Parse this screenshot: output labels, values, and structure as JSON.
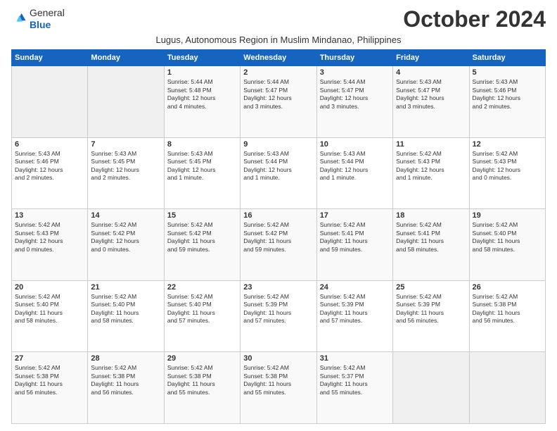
{
  "header": {
    "logo_line1": "General",
    "logo_line2": "Blue",
    "month": "October 2024",
    "location": "Lugus, Autonomous Region in Muslim Mindanao, Philippines"
  },
  "weekdays": [
    "Sunday",
    "Monday",
    "Tuesday",
    "Wednesday",
    "Thursday",
    "Friday",
    "Saturday"
  ],
  "weeks": [
    [
      {
        "day": "",
        "info": ""
      },
      {
        "day": "",
        "info": ""
      },
      {
        "day": "1",
        "info": "Sunrise: 5:44 AM\nSunset: 5:48 PM\nDaylight: 12 hours\nand 4 minutes."
      },
      {
        "day": "2",
        "info": "Sunrise: 5:44 AM\nSunset: 5:47 PM\nDaylight: 12 hours\nand 3 minutes."
      },
      {
        "day": "3",
        "info": "Sunrise: 5:44 AM\nSunset: 5:47 PM\nDaylight: 12 hours\nand 3 minutes."
      },
      {
        "day": "4",
        "info": "Sunrise: 5:43 AM\nSunset: 5:47 PM\nDaylight: 12 hours\nand 3 minutes."
      },
      {
        "day": "5",
        "info": "Sunrise: 5:43 AM\nSunset: 5:46 PM\nDaylight: 12 hours\nand 2 minutes."
      }
    ],
    [
      {
        "day": "6",
        "info": "Sunrise: 5:43 AM\nSunset: 5:46 PM\nDaylight: 12 hours\nand 2 minutes."
      },
      {
        "day": "7",
        "info": "Sunrise: 5:43 AM\nSunset: 5:45 PM\nDaylight: 12 hours\nand 2 minutes."
      },
      {
        "day": "8",
        "info": "Sunrise: 5:43 AM\nSunset: 5:45 PM\nDaylight: 12 hours\nand 1 minute."
      },
      {
        "day": "9",
        "info": "Sunrise: 5:43 AM\nSunset: 5:44 PM\nDaylight: 12 hours\nand 1 minute."
      },
      {
        "day": "10",
        "info": "Sunrise: 5:43 AM\nSunset: 5:44 PM\nDaylight: 12 hours\nand 1 minute."
      },
      {
        "day": "11",
        "info": "Sunrise: 5:42 AM\nSunset: 5:43 PM\nDaylight: 12 hours\nand 1 minute."
      },
      {
        "day": "12",
        "info": "Sunrise: 5:42 AM\nSunset: 5:43 PM\nDaylight: 12 hours\nand 0 minutes."
      }
    ],
    [
      {
        "day": "13",
        "info": "Sunrise: 5:42 AM\nSunset: 5:43 PM\nDaylight: 12 hours\nand 0 minutes."
      },
      {
        "day": "14",
        "info": "Sunrise: 5:42 AM\nSunset: 5:42 PM\nDaylight: 12 hours\nand 0 minutes."
      },
      {
        "day": "15",
        "info": "Sunrise: 5:42 AM\nSunset: 5:42 PM\nDaylight: 11 hours\nand 59 minutes."
      },
      {
        "day": "16",
        "info": "Sunrise: 5:42 AM\nSunset: 5:42 PM\nDaylight: 11 hours\nand 59 minutes."
      },
      {
        "day": "17",
        "info": "Sunrise: 5:42 AM\nSunset: 5:41 PM\nDaylight: 11 hours\nand 59 minutes."
      },
      {
        "day": "18",
        "info": "Sunrise: 5:42 AM\nSunset: 5:41 PM\nDaylight: 11 hours\nand 58 minutes."
      },
      {
        "day": "19",
        "info": "Sunrise: 5:42 AM\nSunset: 5:40 PM\nDaylight: 11 hours\nand 58 minutes."
      }
    ],
    [
      {
        "day": "20",
        "info": "Sunrise: 5:42 AM\nSunset: 5:40 PM\nDaylight: 11 hours\nand 58 minutes."
      },
      {
        "day": "21",
        "info": "Sunrise: 5:42 AM\nSunset: 5:40 PM\nDaylight: 11 hours\nand 58 minutes."
      },
      {
        "day": "22",
        "info": "Sunrise: 5:42 AM\nSunset: 5:40 PM\nDaylight: 11 hours\nand 57 minutes."
      },
      {
        "day": "23",
        "info": "Sunrise: 5:42 AM\nSunset: 5:39 PM\nDaylight: 11 hours\nand 57 minutes."
      },
      {
        "day": "24",
        "info": "Sunrise: 5:42 AM\nSunset: 5:39 PM\nDaylight: 11 hours\nand 57 minutes."
      },
      {
        "day": "25",
        "info": "Sunrise: 5:42 AM\nSunset: 5:39 PM\nDaylight: 11 hours\nand 56 minutes."
      },
      {
        "day": "26",
        "info": "Sunrise: 5:42 AM\nSunset: 5:38 PM\nDaylight: 11 hours\nand 56 minutes."
      }
    ],
    [
      {
        "day": "27",
        "info": "Sunrise: 5:42 AM\nSunset: 5:38 PM\nDaylight: 11 hours\nand 56 minutes."
      },
      {
        "day": "28",
        "info": "Sunrise: 5:42 AM\nSunset: 5:38 PM\nDaylight: 11 hours\nand 56 minutes."
      },
      {
        "day": "29",
        "info": "Sunrise: 5:42 AM\nSunset: 5:38 PM\nDaylight: 11 hours\nand 55 minutes."
      },
      {
        "day": "30",
        "info": "Sunrise: 5:42 AM\nSunset: 5:38 PM\nDaylight: 11 hours\nand 55 minutes."
      },
      {
        "day": "31",
        "info": "Sunrise: 5:42 AM\nSunset: 5:37 PM\nDaylight: 11 hours\nand 55 minutes."
      },
      {
        "day": "",
        "info": ""
      },
      {
        "day": "",
        "info": ""
      }
    ]
  ]
}
